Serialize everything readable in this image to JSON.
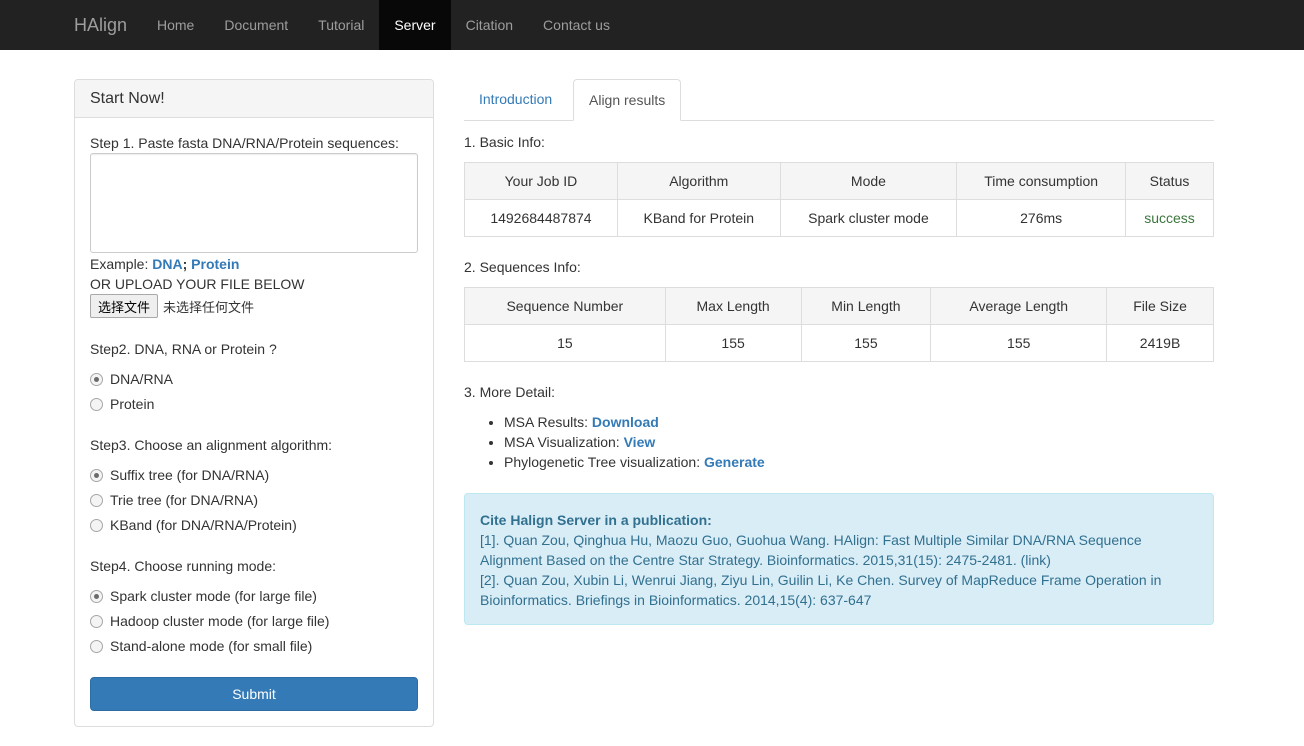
{
  "navbar": {
    "brand": "HAlign",
    "items": [
      {
        "label": "Home",
        "active": false
      },
      {
        "label": "Document",
        "active": false
      },
      {
        "label": "Tutorial",
        "active": false
      },
      {
        "label": "Server",
        "active": true
      },
      {
        "label": "Citation",
        "active": false
      },
      {
        "label": "Contact us",
        "active": false
      }
    ]
  },
  "form": {
    "heading": "Start Now!",
    "step1_label": "Step 1. Paste fasta DNA/RNA/Protein sequences:",
    "textarea_value": "",
    "example_prefix": "Example:",
    "example_dna": "DNA",
    "example_sep": ";",
    "example_protein": "Protein",
    "upload_label": "OR UPLOAD YOUR FILE BELOW",
    "file_button": "选择文件",
    "file_status": "未选择任何文件",
    "step2_label": "Step2. DNA, RNA or Protein ?",
    "step2_options": [
      {
        "label": "DNA/RNA",
        "checked": true
      },
      {
        "label": "Protein",
        "checked": false
      }
    ],
    "step3_label": "Step3. Choose an alignment algorithm:",
    "step3_options": [
      {
        "label": "Suffix tree (for DNA/RNA)",
        "checked": true
      },
      {
        "label": "Trie tree (for DNA/RNA)",
        "checked": false
      },
      {
        "label": "KBand (for DNA/RNA/Protein)",
        "checked": false
      }
    ],
    "step4_label": "Step4. Choose running mode:",
    "step4_options": [
      {
        "label": "Spark cluster mode (for large file)",
        "checked": true
      },
      {
        "label": "Hadoop cluster mode (for large file)",
        "checked": false
      },
      {
        "label": "Stand-alone mode (for small file)",
        "checked": false
      }
    ],
    "submit_label": "Submit"
  },
  "tabs": [
    {
      "label": "Introduction",
      "active": false
    },
    {
      "label": "Align results",
      "active": true
    }
  ],
  "basic_info": {
    "title": "1. Basic Info:",
    "headers": [
      "Your Job ID",
      "Algorithm",
      "Mode",
      "Time consumption",
      "Status"
    ],
    "row": [
      "1492684487874",
      "KBand for Protein",
      "Spark cluster mode",
      "276ms",
      "success"
    ]
  },
  "sequences_info": {
    "title": "2. Sequences Info:",
    "headers": [
      "Sequence Number",
      "Max Length",
      "Min Length",
      "Average Length",
      "File Size"
    ],
    "row": [
      "15",
      "155",
      "155",
      "155",
      "2419B"
    ]
  },
  "more_detail": {
    "title": "3. More Detail:",
    "items": [
      {
        "label": "MSA Results:",
        "link": "Download"
      },
      {
        "label": "MSA Visualization:",
        "link": "View"
      },
      {
        "label": "Phylogenetic Tree visualization:",
        "link": "Generate"
      }
    ]
  },
  "cite": {
    "title": "Cite Halign Server in a publication:",
    "ref1_line1": "[1]. Quan Zou, Qinghua Hu, Maozu Guo, Guohua Wang. HAlign: Fast Multiple Similar DNA/RNA Sequence",
    "ref1_line2": "Alignment Based on the Centre Star Strategy. Bioinformatics. 2015,31(15): 2475-2481. (link)",
    "ref2_line1": "[2]. Quan Zou, Xubin Li, Wenrui Jiang, Ziyu Lin, Guilin Li, Ke Chen. Survey of MapReduce Frame Operation in",
    "ref2_line2": "Bioinformatics. Briefings in Bioinformatics. 2014,15(4): 637-647"
  }
}
